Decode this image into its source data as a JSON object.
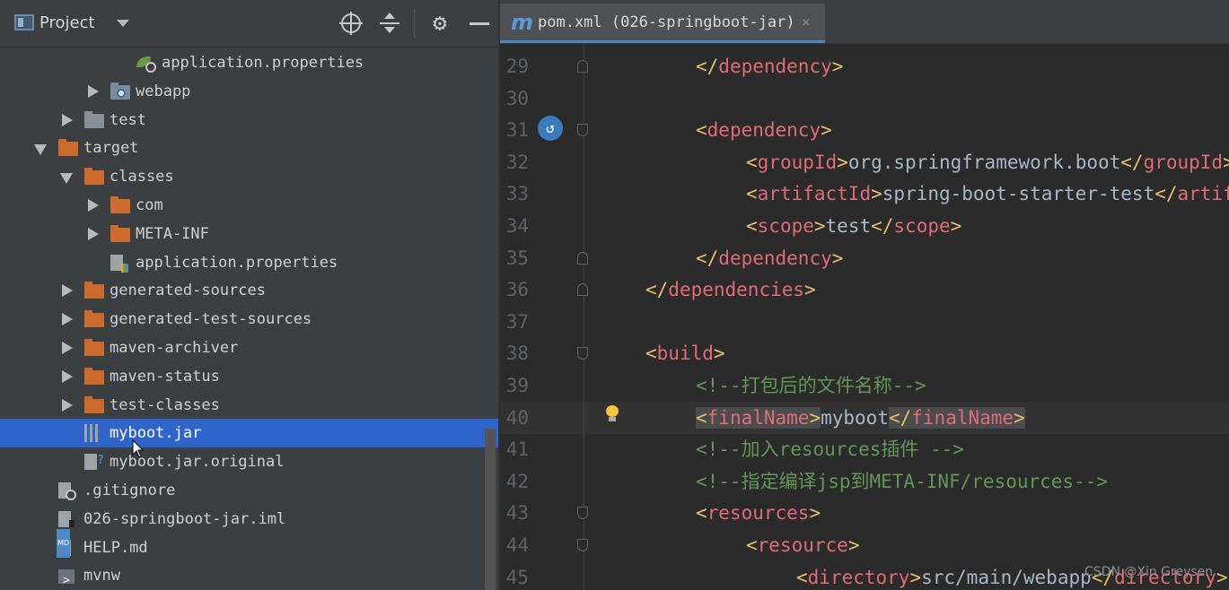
{
  "project_panel": {
    "title": "Project",
    "tree": [
      {
        "label": "application.properties",
        "indent": 5,
        "icon": "spring-properties-file-icon",
        "arrow": "none"
      },
      {
        "label": "webapp",
        "indent": 4,
        "icon": "webapp-folder-icon",
        "arrow": "right"
      },
      {
        "label": "test",
        "indent": 3,
        "icon": "grey-folder-icon",
        "arrow": "right"
      },
      {
        "label": "target",
        "indent": 2,
        "icon": "orange-folder-icon",
        "arrow": "down"
      },
      {
        "label": "classes",
        "indent": 3,
        "icon": "orange-folder-icon",
        "arrow": "down"
      },
      {
        "label": "com",
        "indent": 4,
        "icon": "orange-folder-icon",
        "arrow": "right"
      },
      {
        "label": "META-INF",
        "indent": 4,
        "icon": "orange-folder-icon",
        "arrow": "right"
      },
      {
        "label": "application.properties",
        "indent": 4,
        "icon": "properties-file-icon",
        "arrow": "none"
      },
      {
        "label": "generated-sources",
        "indent": 3,
        "icon": "orange-folder-icon",
        "arrow": "right"
      },
      {
        "label": "generated-test-sources",
        "indent": 3,
        "icon": "orange-folder-icon",
        "arrow": "right"
      },
      {
        "label": "maven-archiver",
        "indent": 3,
        "icon": "orange-folder-icon",
        "arrow": "right"
      },
      {
        "label": "maven-status",
        "indent": 3,
        "icon": "orange-folder-icon",
        "arrow": "right"
      },
      {
        "label": "test-classes",
        "indent": 3,
        "icon": "orange-folder-icon",
        "arrow": "right"
      },
      {
        "label": "myboot.jar",
        "indent": 3,
        "icon": "jar-file-icon",
        "arrow": "none",
        "selected": true
      },
      {
        "label": "myboot.jar.original",
        "indent": 3,
        "icon": "unknown-file-icon",
        "arrow": "none"
      },
      {
        "label": ".gitignore",
        "indent": 2,
        "icon": "gitignore-file-icon",
        "arrow": "none"
      },
      {
        "label": "026-springboot-jar.iml",
        "indent": 2,
        "icon": "iml-file-icon",
        "arrow": "none"
      },
      {
        "label": "HELP.md",
        "indent": 2,
        "icon": "markdown-file-icon",
        "arrow": "none"
      },
      {
        "label": "mvnw",
        "indent": 2,
        "icon": "shell-file-icon",
        "arrow": "none"
      }
    ]
  },
  "editor": {
    "tab": {
      "icon": "m",
      "label": "pom.xml (026-springboot-jar)",
      "close": "×"
    },
    "lines": [
      {
        "n": "29",
        "indent": 2,
        "parts": [
          [
            "b",
            "</"
          ],
          [
            "n",
            "dependency"
          ],
          [
            "b",
            ">"
          ]
        ],
        "fold": "bot"
      },
      {
        "n": "30",
        "indent": 0,
        "parts": []
      },
      {
        "n": "31",
        "indent": 2,
        "parts": [
          [
            "b",
            "<"
          ],
          [
            "n",
            "dependency"
          ],
          [
            "b",
            ">"
          ]
        ],
        "fold": "top"
      },
      {
        "n": "32",
        "indent": 3,
        "parts": [
          [
            "b",
            "<"
          ],
          [
            "n",
            "groupId"
          ],
          [
            "b",
            ">"
          ],
          [
            "t",
            "org.springframework.boot"
          ],
          [
            "b",
            "</"
          ],
          [
            "n",
            "groupId"
          ],
          [
            "b",
            ">"
          ]
        ]
      },
      {
        "n": "33",
        "indent": 3,
        "parts": [
          [
            "b",
            "<"
          ],
          [
            "n",
            "artifactId"
          ],
          [
            "b",
            ">"
          ],
          [
            "t",
            "spring-boot-starter-test"
          ],
          [
            "b",
            "</"
          ],
          [
            "n",
            "artifactId"
          ],
          [
            "b",
            ">"
          ]
        ]
      },
      {
        "n": "34",
        "indent": 3,
        "parts": [
          [
            "b",
            "<"
          ],
          [
            "n",
            "scope"
          ],
          [
            "b",
            ">"
          ],
          [
            "t",
            "test"
          ],
          [
            "b",
            "</"
          ],
          [
            "n",
            "scope"
          ],
          [
            "b",
            ">"
          ]
        ]
      },
      {
        "n": "35",
        "indent": 2,
        "parts": [
          [
            "b",
            "</"
          ],
          [
            "n",
            "dependency"
          ],
          [
            "b",
            ">"
          ]
        ],
        "fold": "bot"
      },
      {
        "n": "36",
        "indent": 1,
        "parts": [
          [
            "b",
            "</"
          ],
          [
            "n",
            "dependencies"
          ],
          [
            "b",
            ">"
          ]
        ],
        "fold": "bot"
      },
      {
        "n": "37",
        "indent": 0,
        "parts": []
      },
      {
        "n": "38",
        "indent": 1,
        "parts": [
          [
            "b",
            "<"
          ],
          [
            "n",
            "build"
          ],
          [
            "b",
            ">"
          ]
        ],
        "fold": "top"
      },
      {
        "n": "39",
        "indent": 2,
        "parts": [
          [
            "c",
            "<!--打包后的文件名称-->"
          ]
        ]
      },
      {
        "n": "40",
        "indent": 2,
        "parts": [
          [
            "hb",
            "<"
          ],
          [
            "hn",
            "finalName"
          ],
          [
            "hb",
            ">"
          ],
          [
            "t",
            "myboot"
          ],
          [
            "hb",
            "</"
          ],
          [
            "hn",
            "finalName"
          ],
          [
            "hb",
            ">"
          ]
        ],
        "current": true
      },
      {
        "n": "41",
        "indent": 2,
        "parts": [
          [
            "c",
            "<!--加入resources插件 -->"
          ]
        ]
      },
      {
        "n": "42",
        "indent": 2,
        "parts": [
          [
            "c",
            "<!--指定编译jsp到META-INF/resources-->"
          ]
        ]
      },
      {
        "n": "43",
        "indent": 2,
        "parts": [
          [
            "b",
            "<"
          ],
          [
            "n",
            "resources"
          ],
          [
            "b",
            ">"
          ]
        ],
        "fold": "top"
      },
      {
        "n": "44",
        "indent": 3,
        "parts": [
          [
            "b",
            "<"
          ],
          [
            "n",
            "resource"
          ],
          [
            "b",
            ">"
          ]
        ],
        "fold": "top"
      },
      {
        "n": "45",
        "indent": 4,
        "parts": [
          [
            "b",
            "<"
          ],
          [
            "n",
            "directory"
          ],
          [
            "b",
            ">"
          ],
          [
            "t",
            "src/main/webapp"
          ],
          [
            "b",
            "</"
          ],
          [
            "n",
            "directory"
          ],
          [
            "b",
            ">"
          ]
        ]
      }
    ]
  },
  "watermark": "CSDN @Xin Greysen",
  "colors": {
    "accent": "#2f65ca",
    "tag": "#e8bf6a",
    "comment": "#629755"
  }
}
